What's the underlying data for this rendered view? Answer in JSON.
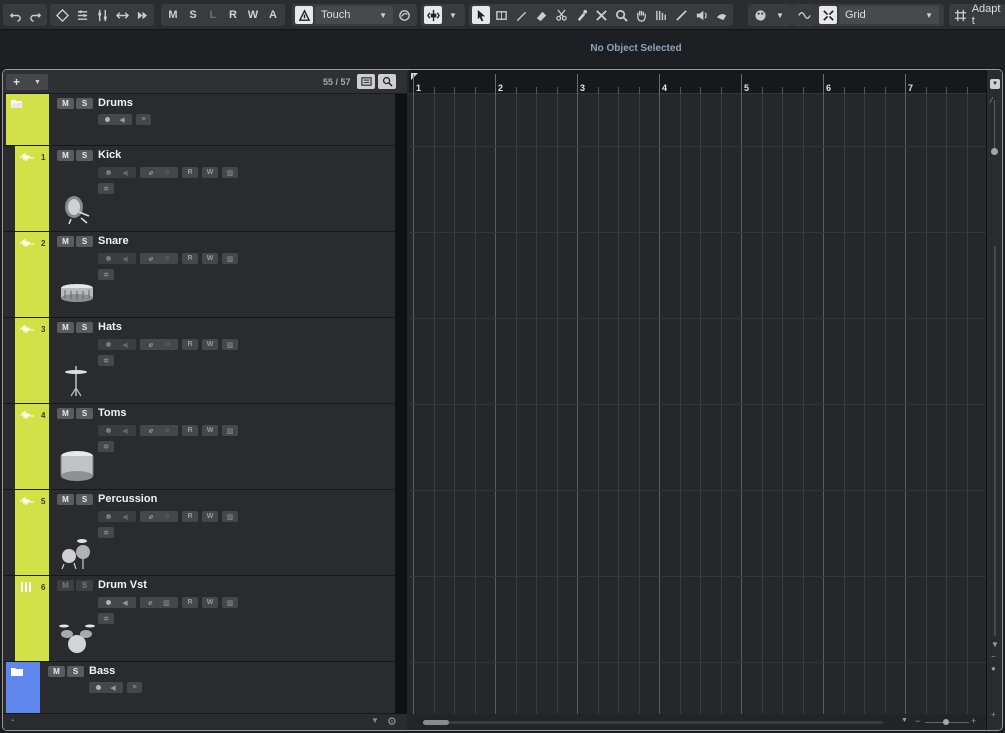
{
  "toolbar": {
    "record_modes": [
      "M",
      "S",
      "L",
      "R",
      "W",
      "A"
    ],
    "automation_mode": "Touch",
    "snap_type": "Grid",
    "adapt_label": "Adapt t"
  },
  "infoline": {
    "message": "No Object Selected"
  },
  "tracklist": {
    "count": "55 / 57",
    "tracks": [
      {
        "name": "Drums",
        "kind": "folder",
        "color": "#d2e147"
      },
      {
        "name": "Kick",
        "number": "1",
        "kind": "instrument",
        "instrument": "kick-drum-icon"
      },
      {
        "name": "Snare",
        "number": "2",
        "kind": "instrument",
        "instrument": "snare-drum-icon"
      },
      {
        "name": "Hats",
        "number": "3",
        "kind": "instrument",
        "instrument": "hi-hat-icon"
      },
      {
        "name": "Toms",
        "number": "4",
        "kind": "instrument",
        "instrument": "tom-drum-icon"
      },
      {
        "name": "Percussion",
        "number": "5",
        "kind": "instrument",
        "instrument": "percussion-icon"
      },
      {
        "name": "Drum Vst",
        "number": "6",
        "kind": "instrument",
        "instrument": "drum-kit-icon"
      },
      {
        "name": "Bass",
        "kind": "folder",
        "color": "#5e86ec"
      }
    ],
    "mute_label": "M",
    "solo_label": "S",
    "read_label": "R",
    "write_label": "W"
  },
  "ruler": {
    "bars": [
      "1",
      "2",
      "3",
      "4",
      "5",
      "6",
      "7"
    ]
  },
  "colors": {
    "accent_green": "#d2e147",
    "accent_blue": "#5e86ec",
    "background": "#26272a"
  }
}
